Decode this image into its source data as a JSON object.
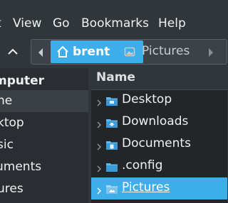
{
  "menubar": {
    "items": [
      "t",
      "View",
      "Go",
      "Bookmarks",
      "Help"
    ]
  },
  "breadcrumb": {
    "items": [
      "brent",
      "Pictures"
    ]
  },
  "sidebar": {
    "header": "mputer",
    "items": [
      "ne",
      "ktop",
      "sic",
      "uments",
      "ures"
    ]
  },
  "fileview": {
    "column_header": "Name",
    "rows": [
      {
        "name": "Desktop",
        "icon": "folder-desktop-icon"
      },
      {
        "name": "Downloads",
        "icon": "folder-download-icon"
      },
      {
        "name": "Documents",
        "icon": "folder-documents-icon"
      },
      {
        "name": ".config",
        "icon": "folder-icon"
      },
      {
        "name": "Pictures",
        "icon": "folder-pictures-icon",
        "selected": true
      }
    ]
  },
  "colors": {
    "accent": "#3daee9",
    "window_bg": "#31363b",
    "view_bg": "#232629",
    "sidebar_bg": "#2a2e32"
  }
}
